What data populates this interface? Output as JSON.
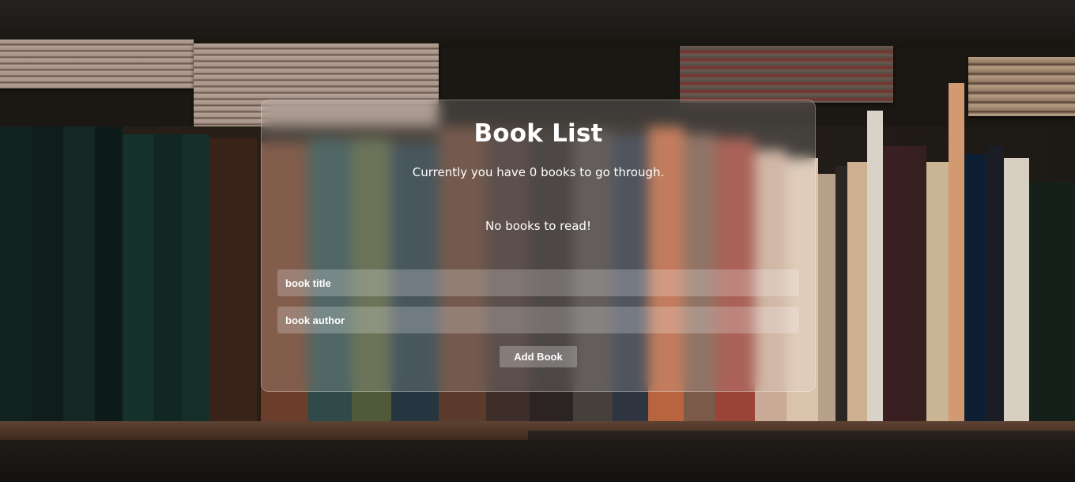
{
  "app": {
    "title": "Book List",
    "subtitle": "Currently you have 0 books to go through.",
    "empty_message": "No books to read!"
  },
  "form": {
    "title_placeholder": "book title",
    "author_placeholder": "book author",
    "submit_label": "Add Book"
  },
  "books": []
}
